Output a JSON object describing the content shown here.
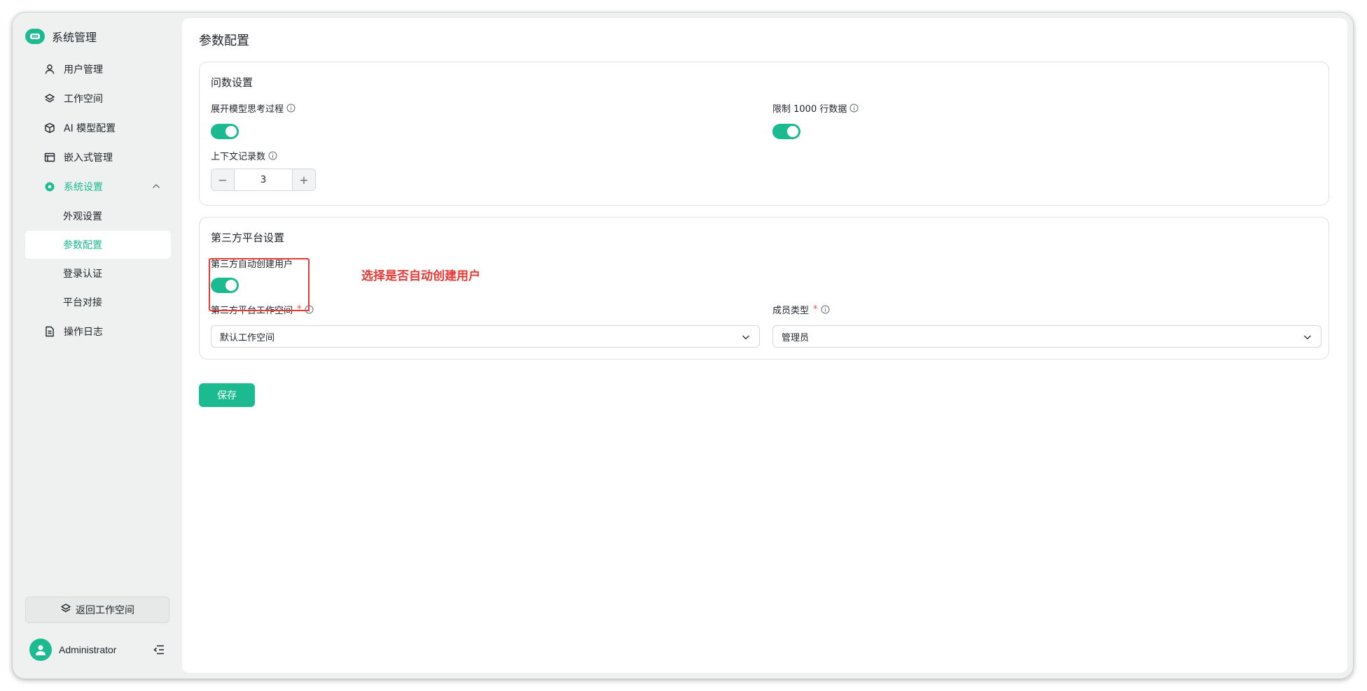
{
  "app": {
    "title": "系统管理"
  },
  "sidebar": {
    "items": [
      {
        "label": "用户管理",
        "icon": "user-icon"
      },
      {
        "label": "工作空间",
        "icon": "layers-icon"
      },
      {
        "label": "AI 模型配置",
        "icon": "cube-icon"
      },
      {
        "label": "嵌入式管理",
        "icon": "window-icon"
      },
      {
        "label": "系统设置",
        "icon": "gear-icon",
        "expanded": true
      },
      {
        "label": "操作日志",
        "icon": "document-icon"
      }
    ],
    "sub_items": [
      {
        "label": "外观设置"
      },
      {
        "label": "参数配置",
        "active": true
      },
      {
        "label": "登录认证"
      },
      {
        "label": "平台对接"
      }
    ],
    "return_label": "返回工作空间",
    "user_name": "Administrator"
  },
  "main": {
    "page_title": "参数配置",
    "qa_section": {
      "title": "问数设置",
      "expand_thinking_label": "展开模型思考过程",
      "expand_thinking_on": true,
      "limit_rows_label": "限制 1000 行数据",
      "limit_rows_on": true,
      "context_count_label": "上下文记录数",
      "context_count_value": "3",
      "minus": "−",
      "plus": "+"
    },
    "third_party_section": {
      "title": "第三方平台设置",
      "auto_create_label": "第三方自动创建用户",
      "auto_create_on": true,
      "workspace_label": "第三方平台工作空间",
      "workspace_required": "*",
      "workspace_value": "默认工作空间",
      "member_type_label": "成员类型",
      "member_type_required": "*",
      "member_type_value": "管理员"
    },
    "save_label": "保存"
  },
  "annotation": {
    "text": "选择是否自动创建用户",
    "color": "#e53935"
  },
  "colors": {
    "accent": "#1cba90",
    "sidebar_bg": "#eef1f0",
    "annotation": "#e53935"
  }
}
